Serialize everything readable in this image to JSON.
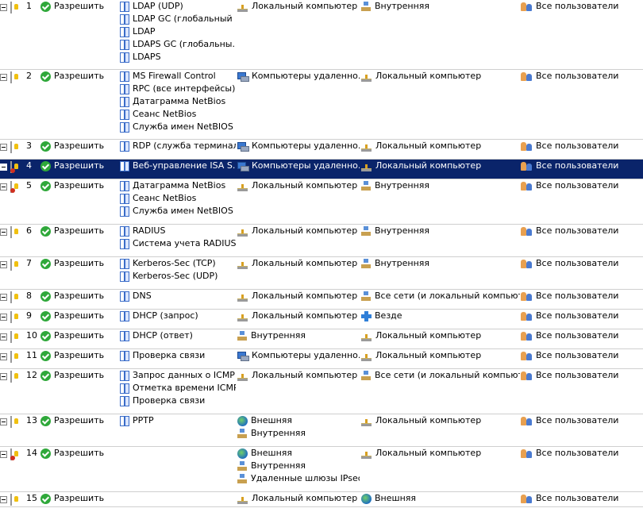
{
  "rules": [
    {
      "num": "1",
      "type": "access",
      "action": "Разрешить",
      "protocols": [
        "LDAP (UDP)",
        "LDAP GC (глобальный ...",
        "LDAP",
        "LDAPS GC (глобальны...",
        "LDAPS"
      ],
      "sources": [
        {
          "icon": "computer",
          "label": "Локальный компьютер"
        }
      ],
      "destinations": [
        {
          "icon": "network",
          "label": "Внутренняя"
        }
      ],
      "users": "Все пользователи"
    },
    {
      "num": "2",
      "type": "access",
      "action": "Разрешить",
      "protocols": [
        "MS Firewall Control",
        "RPC (все интерфейсы)",
        "Датаграмма NetBios",
        "Сеанс NetBios",
        "Служба имен NetBIOS"
      ],
      "sources": [
        {
          "icon": "computers",
          "label": "Компьютеры удаленно..."
        }
      ],
      "destinations": [
        {
          "icon": "computer",
          "label": "Локальный компьютер"
        }
      ],
      "users": "Все пользователи"
    },
    {
      "num": "3",
      "type": "access",
      "action": "Разрешить",
      "protocols": [
        "RDP (служба терминал..."
      ],
      "sources": [
        {
          "icon": "computers",
          "label": "Компьютеры удаленно..."
        }
      ],
      "destinations": [
        {
          "icon": "computer",
          "label": "Локальный компьютер"
        }
      ],
      "users": "Все пользователи"
    },
    {
      "num": "4",
      "type": "publish",
      "action": "Разрешить",
      "protocols": [
        "Веб-управление ISA S..."
      ],
      "sources": [
        {
          "icon": "computers",
          "label": "Компьютеры удаленно..."
        }
      ],
      "destinations": [
        {
          "icon": "computer",
          "label": "Локальный компьютер"
        }
      ],
      "users": "Все пользователи",
      "selected": true
    },
    {
      "num": "5",
      "type": "publish",
      "action": "Разрешить",
      "protocols": [
        "Датаграмма NetBios",
        "Сеанс NetBios",
        "Служба имен NetBIOS"
      ],
      "sources": [
        {
          "icon": "computer",
          "label": "Локальный компьютер"
        }
      ],
      "destinations": [
        {
          "icon": "network",
          "label": "Внутренняя"
        }
      ],
      "users": "Все пользователи"
    },
    {
      "num": "6",
      "type": "access",
      "action": "Разрешить",
      "protocols": [
        "RADIUS",
        "Система учета RADIUS"
      ],
      "sources": [
        {
          "icon": "computer",
          "label": "Локальный компьютер"
        }
      ],
      "destinations": [
        {
          "icon": "network",
          "label": "Внутренняя"
        }
      ],
      "users": "Все пользователи"
    },
    {
      "num": "7",
      "type": "access",
      "action": "Разрешить",
      "protocols": [
        "Kerberos-Sec (TCP)",
        "Kerberos-Sec (UDP)"
      ],
      "sources": [
        {
          "icon": "computer",
          "label": "Локальный компьютер"
        }
      ],
      "destinations": [
        {
          "icon": "network",
          "label": "Внутренняя"
        }
      ],
      "users": "Все пользователи"
    },
    {
      "num": "8",
      "type": "access",
      "action": "Разрешить",
      "protocols": [
        "DNS"
      ],
      "sources": [
        {
          "icon": "computer",
          "label": "Локальный компьютер"
        }
      ],
      "destinations": [
        {
          "icon": "network",
          "label": "Все сети (и локальный компьютер)"
        }
      ],
      "users": "Все пользователи"
    },
    {
      "num": "9",
      "type": "access",
      "action": "Разрешить",
      "protocols": [
        "DHCP (запрос)"
      ],
      "sources": [
        {
          "icon": "computer",
          "label": "Локальный компьютер"
        }
      ],
      "destinations": [
        {
          "icon": "anywhere",
          "label": "Везде"
        }
      ],
      "users": "Все пользователи"
    },
    {
      "num": "10",
      "type": "access",
      "action": "Разрешить",
      "protocols": [
        "DHCP (ответ)"
      ],
      "sources": [
        {
          "icon": "network",
          "label": "Внутренняя"
        }
      ],
      "destinations": [
        {
          "icon": "computer",
          "label": "Локальный компьютер"
        }
      ],
      "users": "Все пользователи"
    },
    {
      "num": "11",
      "type": "access",
      "action": "Разрешить",
      "protocols": [
        "Проверка связи"
      ],
      "sources": [
        {
          "icon": "computers",
          "label": "Компьютеры удаленно..."
        }
      ],
      "destinations": [
        {
          "icon": "computer",
          "label": "Локальный компьютер"
        }
      ],
      "users": "Все пользователи"
    },
    {
      "num": "12",
      "type": "access",
      "action": "Разрешить",
      "protocols": [
        "Запрос данных о ICMP",
        "Отметка времени ICMP",
        "Проверка связи"
      ],
      "sources": [
        {
          "icon": "computer",
          "label": "Локальный компьютер"
        }
      ],
      "destinations": [
        {
          "icon": "network",
          "label": "Все сети (и локальный компьютер)"
        }
      ],
      "users": "Все пользователи"
    },
    {
      "num": "13",
      "type": "access",
      "action": "Разрешить",
      "protocols": [
        "PPTP"
      ],
      "sources": [
        {
          "icon": "globe",
          "label": "Внешняя"
        },
        {
          "icon": "network",
          "label": "Внутренняя"
        }
      ],
      "destinations": [
        {
          "icon": "computer",
          "label": "Локальный компьютер"
        }
      ],
      "users": "Все пользователи"
    },
    {
      "num": "14",
      "type": "publish",
      "action": "Разрешить",
      "protocols": [],
      "sources": [
        {
          "icon": "globe",
          "label": "Внешняя"
        },
        {
          "icon": "network",
          "label": "Внутренняя"
        },
        {
          "icon": "network",
          "label": "Удаленные шлюзы IPsec"
        }
      ],
      "destinations": [
        {
          "icon": "computer",
          "label": "Локальный компьютер"
        }
      ],
      "users": "Все пользователи"
    },
    {
      "num": "15",
      "type": "access",
      "action": "Разрешить",
      "protocols": [],
      "sources": [
        {
          "icon": "computer",
          "label": "Локальный компьютер"
        }
      ],
      "destinations": [
        {
          "icon": "globe",
          "label": "Внешняя"
        }
      ],
      "users": "Все пользователи"
    }
  ]
}
